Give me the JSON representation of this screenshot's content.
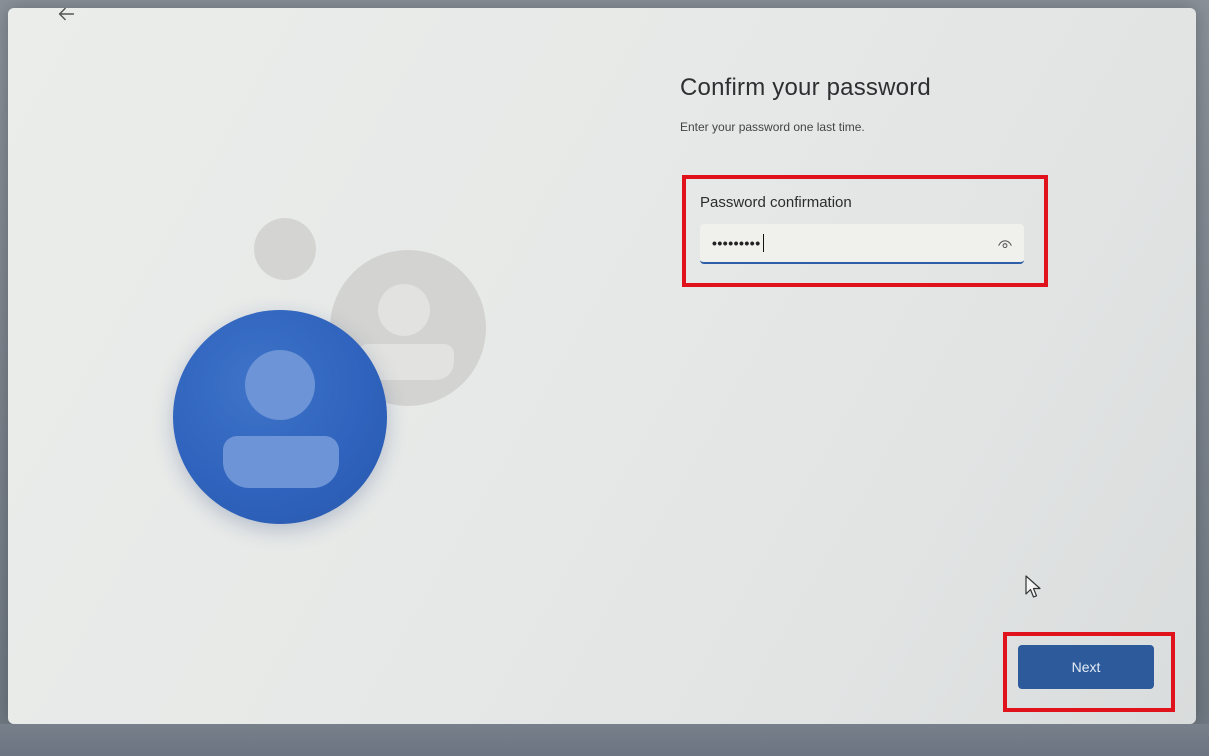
{
  "header": {
    "title": "Confirm your password",
    "subtitle": "Enter your password one last time."
  },
  "password_field": {
    "label": "Password confirmation",
    "value": "•••••••••",
    "reveal_icon": "eye-icon"
  },
  "footer": {
    "next_label": "Next"
  },
  "icons": {
    "back": "back-arrow-icon",
    "cursor": "mouse-pointer-icon"
  },
  "colors": {
    "accent": "#2c5a9a",
    "highlight": "#e0131c",
    "avatar_blue": "#2f63bd",
    "avatar_grey": "#d3d3d1"
  }
}
